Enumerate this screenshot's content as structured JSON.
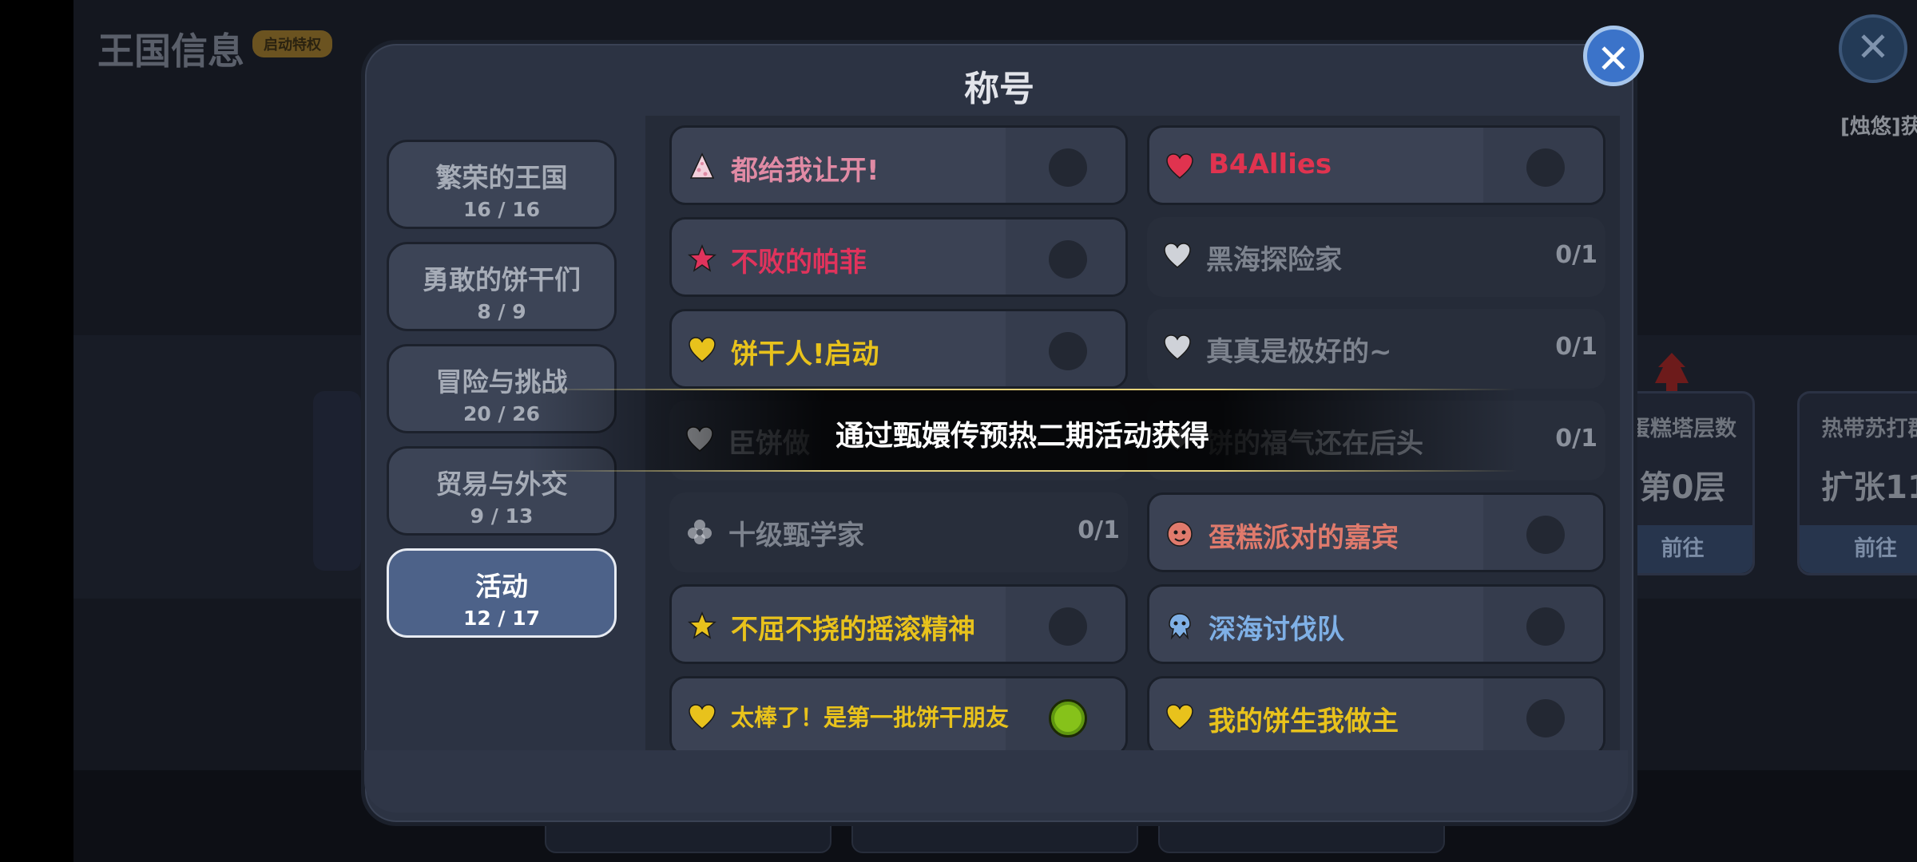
{
  "background": {
    "page_title": "王国信息",
    "badge": "启动特权",
    "right_text": "[烛悠]获",
    "cards": [
      {
        "label": "蛋糕塔层数",
        "value": "第0层",
        "button": "前往"
      },
      {
        "label": "热带苏打群",
        "value": "扩张11",
        "button": "前往"
      }
    ]
  },
  "modal": {
    "title": "称号",
    "close_glyph": "✕",
    "categories": [
      {
        "name": "繁荣的王国",
        "count": "16 / 16"
      },
      {
        "name": "勇敢的饼干们",
        "count": "8 / 9"
      },
      {
        "name": "冒险与挑战",
        "count": "20 / 26"
      },
      {
        "name": "贸易与外交",
        "count": "9 / 13"
      },
      {
        "name": "活动",
        "count": "12 / 17",
        "active": true
      }
    ],
    "titles": [
      {
        "label": "都给我让开!",
        "icon": "party-hat-icon",
        "color": "#e08aa4",
        "owned": true
      },
      {
        "label": "B4Allies",
        "icon": "heart-icon",
        "color": "#e0334f",
        "owned": true
      },
      {
        "label": "不败的帕菲",
        "icon": "star-icon",
        "color": "#e0335c",
        "owned": true
      },
      {
        "label": "黑海探险家",
        "icon": "heart-icon",
        "color": "#cfd2d8",
        "owned": false,
        "progress": "0/1"
      },
      {
        "label": "饼干人!启动",
        "icon": "heart-icon",
        "color": "#e8c21c",
        "owned": true
      },
      {
        "label": "真真是极好的~",
        "icon": "heart-icon",
        "color": "#cfd2d8",
        "owned": false,
        "progress": "0/1"
      },
      {
        "label": "臣饼做",
        "icon": "heart-icon",
        "color": "#cfd2d8",
        "owned": false,
        "progress": "0/1"
      },
      {
        "label": "饼的福气还在后头",
        "icon": "heart-icon",
        "color": "#cfd2d8",
        "owned": false,
        "progress": "0/1"
      },
      {
        "label": "十级甄学家",
        "icon": "flower-icon",
        "color": "#cfd2d8",
        "owned": false,
        "progress": "0/1"
      },
      {
        "label": "蛋糕派对的嘉宾",
        "icon": "mascot-icon",
        "color": "#e07a6c",
        "owned": true
      },
      {
        "label": "不屈不挠的摇滚精神",
        "icon": "star-icon",
        "color": "#e8c21c",
        "owned": true
      },
      {
        "label": "深海讨伐队",
        "icon": "squid-icon",
        "color": "#7fb0e6",
        "owned": true
      },
      {
        "label": "太棒了！是第一批饼干朋友",
        "icon": "heart-icon",
        "color": "#e8c21c",
        "owned": true,
        "equipped": true
      },
      {
        "label": "我的饼生我做主",
        "icon": "heart-icon",
        "color": "#e8c21c",
        "owned": true
      }
    ]
  },
  "toast": {
    "text": "通过甄嬛传预热二期活动获得"
  }
}
